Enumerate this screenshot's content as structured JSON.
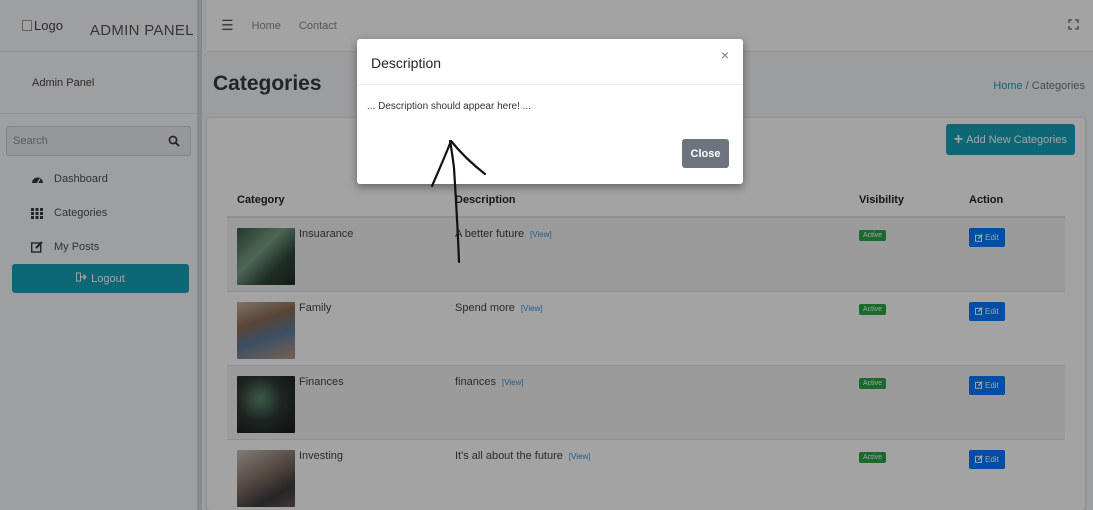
{
  "sidebar": {
    "logo_alt": "Logo",
    "brand": "ADMIN PANEL",
    "user": "Admin Panel",
    "search_placeholder": "Search",
    "nav": [
      {
        "label": "Dashboard",
        "icon": "tachometer-icon"
      },
      {
        "label": "Categories",
        "icon": "grid-icon"
      },
      {
        "label": "My Posts",
        "icon": "edit-icon"
      }
    ],
    "logout": "Logout"
  },
  "topbar": {
    "links": [
      "Home",
      "Contact"
    ]
  },
  "page": {
    "title": "Categories",
    "breadcrumb": {
      "home": "Home",
      "separator": "/",
      "current": "Categories"
    },
    "add_button": "Add New Categories"
  },
  "table": {
    "headers": [
      "Category",
      "Description",
      "Visibility",
      "Action"
    ],
    "rows": [
      {
        "category": "Insuarance",
        "description": "A better future",
        "view": "[View]",
        "visibility": "Active",
        "action": "Edit"
      },
      {
        "category": "Family",
        "description": "Spend more",
        "view": "[View]",
        "visibility": "Active",
        "action": "Edit"
      },
      {
        "category": "Finances",
        "description": "finances",
        "view": "[View]",
        "visibility": "Active",
        "action": "Edit"
      },
      {
        "category": "Investing",
        "description": "It's all about the future",
        "view": "[View]",
        "visibility": "Active",
        "action": "Edit"
      }
    ]
  },
  "modal": {
    "title": "Description",
    "close_x": "×",
    "body": "... Description should appear here! ...",
    "close_button": "Close"
  },
  "colors": {
    "accent": "#17a2b8",
    "active_badge": "#28a745",
    "edit_button": "#007bff",
    "close_button": "#6c757d"
  }
}
